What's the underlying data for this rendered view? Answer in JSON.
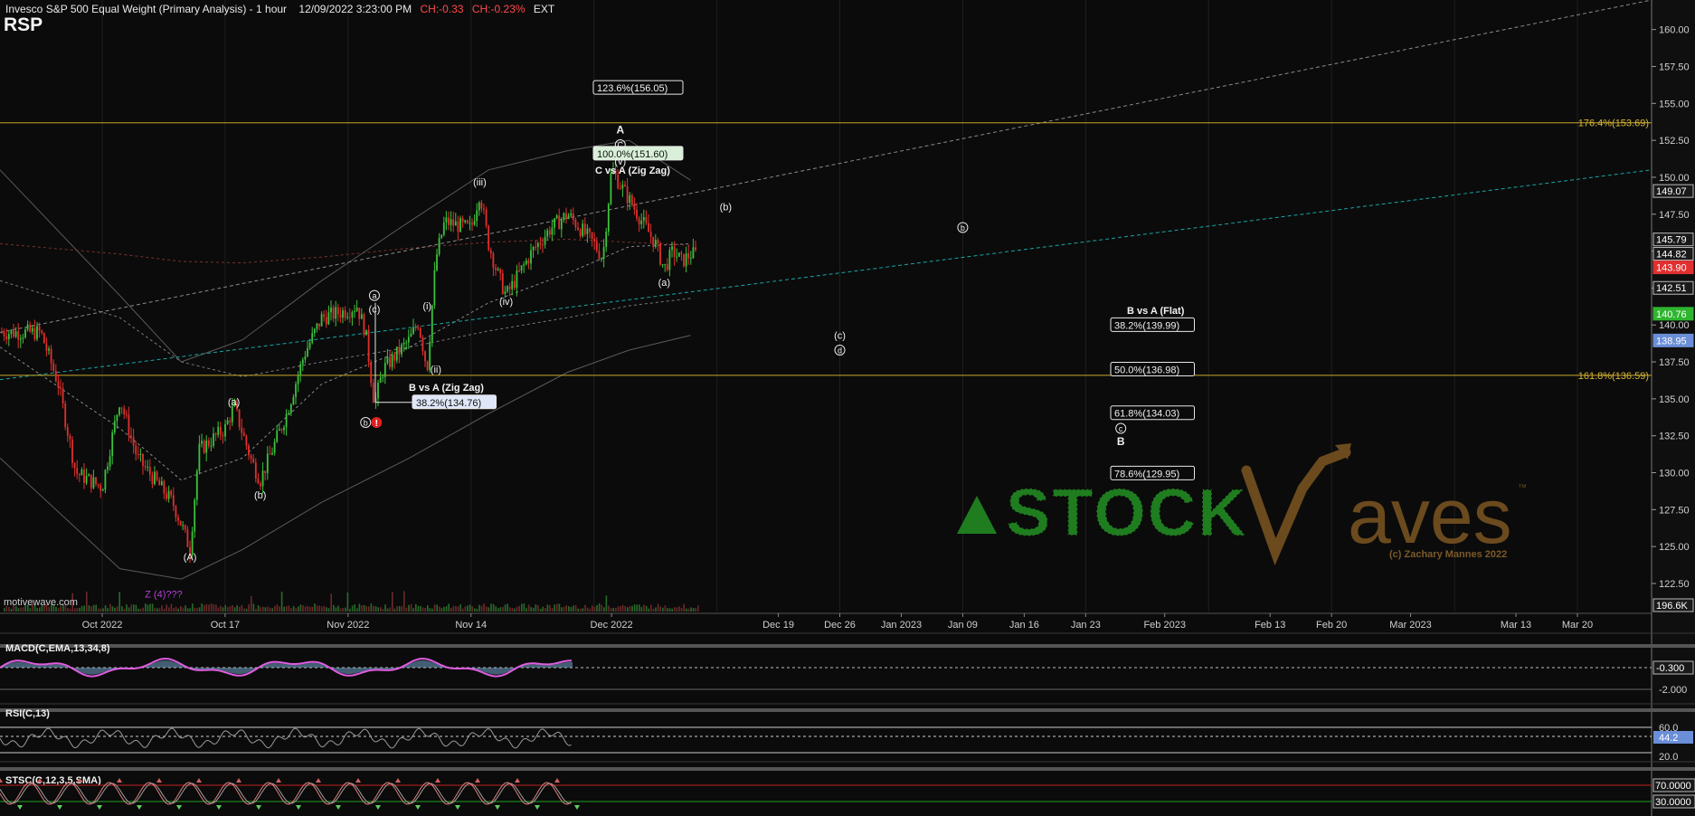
{
  "header": {
    "title": "Invesco S&P 500 Equal Weight (Primary Analysis) - 1 hour",
    "datetime": "12/09/2022 3:23:00 PM",
    "change": "CH:-0.33",
    "change_pct": "CH:-0.23%",
    "session": "EXT",
    "symbol": "RSP"
  },
  "watermark": "motivewave.com",
  "logo": {
    "text": "STOCK Waves",
    "tm": "™",
    "copyright": "(c) Zachary Mannes 2022"
  },
  "colors": {
    "background": "#0b0b0b",
    "up_candle": "#3cc23c",
    "down_candle": "#e0302c",
    "fib_line": "#c8a828",
    "teal_line": "#1aa5a5",
    "macd_line": "#e05ce0",
    "macd_hist": "#7fb6e0",
    "price_tag": "#e03030",
    "green_tag": "#2fb52f",
    "blue_tag": "#6a8ed8",
    "logo_green": "#1f7d1f",
    "logo_brown": "#6b4a1e",
    "purple_label": "#b040d0"
  },
  "chart_data": {
    "type": "candlestick",
    "x_axis_labels": [
      "Oct 2022",
      "Oct 17",
      "Nov 2022",
      "Nov 14",
      "Dec 2022",
      "Dec 19",
      "Dec 26",
      "Jan 2023",
      "Jan 09",
      "Jan 16",
      "Jan 23",
      "Feb 2023",
      "Feb 13",
      "Feb 20",
      "Mar 2023",
      "Mar 13",
      "Mar 20"
    ],
    "y_ticks": [
      "160.00",
      "157.50",
      "155.00",
      "152.50",
      "150.00",
      "147.50",
      "145.00",
      "142.50",
      "140.00",
      "137.50",
      "135.00",
      "132.50",
      "130.00",
      "127.50",
      "125.00",
      "122.50"
    ],
    "ylim": [
      120.6,
      162.0
    ],
    "price_path": [
      [
        "Sep 26",
        139.5
      ],
      [
        "Sep 28",
        136.0
      ],
      [
        "Sep 30",
        130.0
      ],
      [
        "Oct 03",
        129.0
      ],
      [
        "Oct 05",
        135.0
      ],
      [
        "Oct 07",
        131.0
      ],
      [
        "Oct 11",
        128.0
      ],
      [
        "Oct 12",
        126.5
      ],
      [
        "Oct 13",
        124.8
      ],
      [
        "Oct 14",
        131.5
      ],
      [
        "Oct 17",
        133.0
      ],
      [
        "Oct 18",
        134.5
      ],
      [
        "Oct 20",
        130.8
      ],
      [
        "Oct 21",
        129.5
      ],
      [
        "Oct 24",
        134.0
      ],
      [
        "Oct 26",
        138.0
      ],
      [
        "Oct 28",
        140.5
      ],
      [
        "Oct 31",
        141.0
      ],
      [
        "Nov 01",
        141.3
      ],
      [
        "Nov 02",
        139.5
      ],
      [
        "Nov 03",
        134.6
      ],
      [
        "Nov 04",
        137.0
      ],
      [
        "Nov 07",
        139.0
      ],
      [
        "Nov 08",
        140.2
      ],
      [
        "Nov 09",
        137.0
      ],
      [
        "Nov 10",
        144.5
      ],
      [
        "Nov 11",
        147.0
      ],
      [
        "Nov 14",
        146.5
      ],
      [
        "Nov 15",
        149.0
      ],
      [
        "Nov 16",
        145.5
      ],
      [
        "Nov 17",
        143.5
      ],
      [
        "Nov 18",
        142.0
      ],
      [
        "Nov 21",
        145.0
      ],
      [
        "Nov 23",
        146.5
      ],
      [
        "Nov 25",
        147.5
      ],
      [
        "Nov 28",
        145.5
      ],
      [
        "Nov 29",
        144.5
      ],
      [
        "Nov 30",
        150.5
      ],
      [
        "Dec 01",
        149.5
      ],
      [
        "Dec 02",
        148.5
      ],
      [
        "Dec 05",
        145.5
      ],
      [
        "Dec 06",
        143.8
      ],
      [
        "Dec 07",
        145.0
      ],
      [
        "Dec 08",
        144.3
      ],
      [
        "Dec 09",
        144.8
      ]
    ],
    "price_labels": [
      {
        "label": "149.07",
        "value": 149.07,
        "style": "plain"
      },
      {
        "label": "145.79",
        "value": 145.79,
        "style": "plain"
      },
      {
        "label": "144.82",
        "value": 144.82,
        "style": "plain"
      },
      {
        "label": "143.90",
        "value": 143.9,
        "style": "red"
      },
      {
        "label": "142.51",
        "value": 142.51,
        "style": "plain"
      },
      {
        "label": "140.76",
        "value": 140.76,
        "style": "green"
      },
      {
        "label": "138.95",
        "value": 138.95,
        "style": "blue"
      },
      {
        "label": "196.6K",
        "value": 120.6,
        "style": "plain"
      }
    ],
    "fib_horizontal": [
      {
        "label": "176.4%(153.69)",
        "value": 153.69
      },
      {
        "label": "161.8%(136.59)",
        "value": 136.59
      }
    ],
    "fib_boxes": [
      {
        "label": "123.6%(156.05)",
        "value": 156.05,
        "x_date": "Dec 01",
        "style": "plain"
      },
      {
        "label": "100.0%(151.60)",
        "value": 151.6,
        "x_date": "Dec 01",
        "style": "green"
      },
      {
        "label": "38.2%(134.76)",
        "value": 134.76,
        "x_date": "Nov 03",
        "style": "blue"
      },
      {
        "label": "38.2%(139.99)",
        "value": 139.99,
        "x_date": "Jan 26",
        "style": "plain"
      },
      {
        "label": "50.0%(136.98)",
        "value": 136.98,
        "x_date": "Jan 26",
        "style": "plain"
      },
      {
        "label": "61.8%(134.03)",
        "value": 134.03,
        "x_date": "Jan 26",
        "style": "plain"
      },
      {
        "label": "78.6%(129.95)",
        "value": 129.95,
        "x_date": "Jan 26",
        "style": "plain"
      }
    ],
    "fib_titles": [
      {
        "text": "C vs A (Zig Zag)",
        "value": 150.5,
        "x_date": "Dec 04"
      },
      {
        "text": "B vs A (Zig Zag)",
        "value": 135.8,
        "x_date": "Nov 15"
      },
      {
        "text": "B vs A (Flat)",
        "value": 141.0,
        "x_date": "Feb 02"
      }
    ],
    "wave_labels": [
      {
        "text": "A",
        "value": 153.2,
        "x_date": "Dec 01",
        "bold": true
      },
      {
        "text": "C",
        "value": 152.2,
        "x_date": "Dec 01",
        "circle": true
      },
      {
        "text": "(v)",
        "value": 151.1,
        "x_date": "Dec 01"
      },
      {
        "text": "(iii)",
        "value": 149.7,
        "x_date": "Nov 15"
      },
      {
        "text": "(iv)",
        "value": 141.6,
        "x_date": "Nov 18"
      },
      {
        "text": "(a)",
        "value": 142.9,
        "x_date": "Dec 06"
      },
      {
        "text": "(b)",
        "value": 148.0,
        "x_date": "Dec 13"
      },
      {
        "text": "b",
        "value": 146.6,
        "x_date": "Jan 09",
        "circle": true
      },
      {
        "text": "(c)",
        "value": 139.3,
        "x_date": "Dec 26"
      },
      {
        "text": "d",
        "value": 138.3,
        "x_date": "Dec 26",
        "circle": true
      },
      {
        "text": "c",
        "value": 133.0,
        "x_date": "Jan 27",
        "circle": true
      },
      {
        "text": "B",
        "value": 132.1,
        "x_date": "Jan 27",
        "bold": true
      },
      {
        "text": "a",
        "value": 142.0,
        "x_date": "Nov 03",
        "circle": true
      },
      {
        "text": "(c)",
        "value": 141.1,
        "x_date": "Nov 03"
      },
      {
        "text": "(i)",
        "value": 141.3,
        "x_date": "Nov 09"
      },
      {
        "text": "(ii)",
        "value": 137.0,
        "x_date": "Nov 10"
      },
      {
        "text": "b",
        "value": 133.4,
        "x_date": "Nov 02",
        "circle": true
      },
      {
        "text": "(a)",
        "value": 134.8,
        "x_date": "Oct 18"
      },
      {
        "text": "(b)",
        "value": 128.5,
        "x_date": "Oct 21"
      },
      {
        "text": "(A)",
        "value": 124.3,
        "x_date": "Oct 13"
      },
      {
        "text": "Z (4)???",
        "value": 121.8,
        "x_date": "Oct 10",
        "purple": true
      }
    ]
  },
  "indicators": {
    "macd": {
      "label": "MACD(C,EMA,13,34,8)",
      "ticks": [
        "-0.300",
        "-2.000"
      ]
    },
    "rsi": {
      "label": "RSI(C,13)",
      "ticks": [
        "60.0",
        "44.2",
        "20.0"
      ]
    },
    "stoch": {
      "label": "STSC(C,12,3,5,SMA)",
      "ticks": [
        "70.0000",
        "30.0000"
      ]
    }
  }
}
